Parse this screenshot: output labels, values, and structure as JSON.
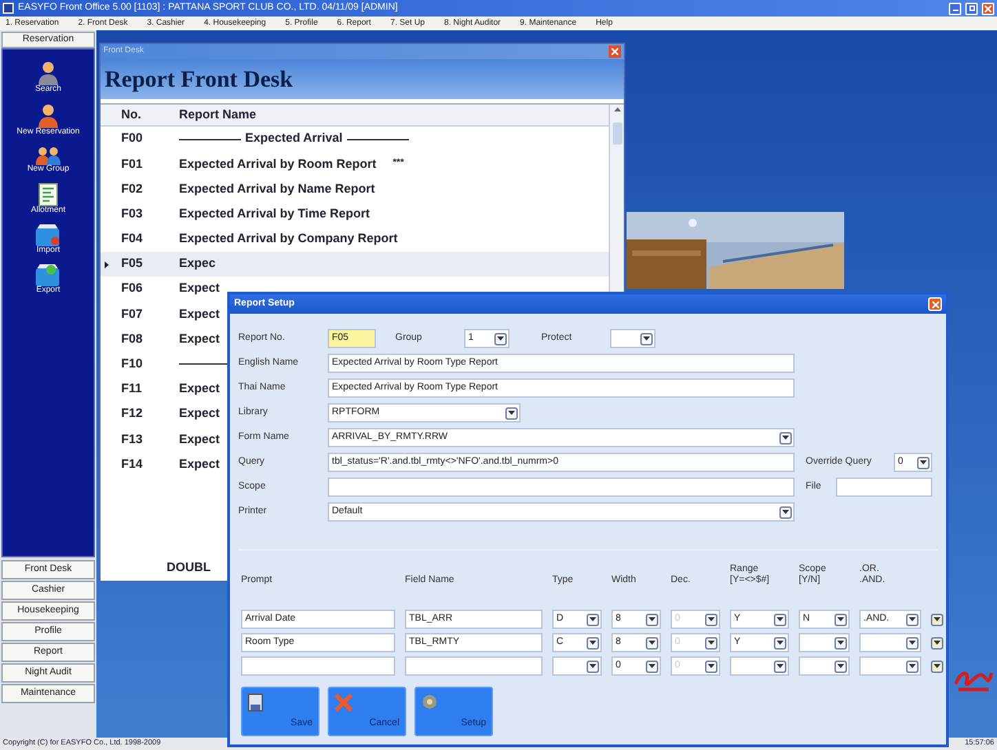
{
  "window": {
    "title": "EASYFO Front Office 5.00 [1103] : PATTANA SPORT CLUB CO., LTD.  04/11/09 [ADMIN]"
  },
  "menu": [
    "1. Reservation",
    "2. Front Desk",
    "3. Cashier",
    "4. Housekeeping",
    "5. Profile",
    "6. Report",
    "7. Set Up",
    "8. Night Auditor",
    "9. Maintenance",
    "Help"
  ],
  "sidebar": {
    "tab": "Reservation",
    "items": [
      {
        "label": "Search",
        "kind": "person"
      },
      {
        "label": "New Reservation",
        "kind": "person-alt"
      },
      {
        "label": "New Group",
        "kind": "group"
      },
      {
        "label": "Allotment",
        "kind": "list"
      },
      {
        "label": "Import",
        "kind": "import"
      },
      {
        "label": "Export",
        "kind": "export"
      }
    ],
    "modules": [
      "Front Desk",
      "Cashier",
      "Housekeeping",
      "Profile",
      "Report",
      "Night Audit",
      "Maintenance"
    ]
  },
  "front_desk": {
    "title": "Front Desk",
    "heading": "Report Front Desk",
    "columns": [
      "No.",
      "Report Name"
    ],
    "rows": [
      {
        "no": "F00",
        "name": "Expected Arrival",
        "kind": "section",
        "selected": false
      },
      {
        "no": "F01",
        "name": "Expected Arrival by Room Report",
        "flag": "***",
        "kind": "report",
        "selected": false
      },
      {
        "no": "F02",
        "name": "Expected Arrival by Name Report",
        "kind": "report",
        "selected": false
      },
      {
        "no": "F03",
        "name": "Expected Arrival by Time Report",
        "kind": "report",
        "selected": false
      },
      {
        "no": "F04",
        "name": "Expected Arrival by Company Report",
        "kind": "report",
        "selected": false
      },
      {
        "no": "F05",
        "name": "Expec",
        "kind": "report",
        "selected": true
      },
      {
        "no": "F06",
        "name": "Expect",
        "kind": "report",
        "selected": false
      },
      {
        "no": "F07",
        "name": "Expect",
        "kind": "report",
        "selected": false
      },
      {
        "no": "F08",
        "name": "Expect",
        "kind": "report",
        "selected": false
      },
      {
        "no": "F10",
        "kind": "section",
        "selected": false
      },
      {
        "no": "F11",
        "name": "Expect",
        "kind": "report",
        "selected": false
      },
      {
        "no": "F12",
        "name": "Expect",
        "kind": "report",
        "selected": false
      },
      {
        "no": "F13",
        "name": "Expect",
        "kind": "report",
        "selected": false
      },
      {
        "no": "F14",
        "name": "Expect",
        "kind": "report",
        "selected": false
      }
    ],
    "footer": "DOUBL"
  },
  "report_setup": {
    "title": "Report Setup",
    "report_no": {
      "label": "Report No.",
      "value": "F05"
    },
    "group": {
      "label": "Group",
      "value": "1"
    },
    "protect": {
      "label": "Protect"
    },
    "english_name": {
      "label": "English Name",
      "value": "Expected Arrival by Room Type Report"
    },
    "thai_name": {
      "label": "Thai Name",
      "value": "Expected Arrival by Room Type Report"
    },
    "library": {
      "label": "Library",
      "value": "RPTFORM"
    },
    "form_name": {
      "label": "Form Name",
      "value": "ARRIVAL_BY_RMTY.RRW"
    },
    "query": {
      "label": "Query",
      "value": "tbl_status='R'.and.tbl_rmty<>'NFO'.and.tbl_numrm>0"
    },
    "override_query": {
      "label": "Override Query",
      "value": "0"
    },
    "scope": {
      "label": "Scope"
    },
    "file": {
      "label": "File"
    },
    "printer": {
      "label": "Printer",
      "value": "Default"
    },
    "grid": {
      "columns": [
        {
          "label": "Prompt",
          "kind": "text",
          "disabled": false
        },
        {
          "label": "Field Name",
          "kind": "text",
          "disabled": false
        },
        {
          "label": "Type",
          "kind": "select",
          "disabled": false
        },
        {
          "label": "Width",
          "kind": "select",
          "disabled": false
        },
        {
          "label": "Dec.",
          "kind": "select",
          "disabled": true
        },
        {
          "label": "Range",
          "sub": "[Y=<>$#]",
          "kind": "select",
          "disabled": false
        },
        {
          "label": "Scope",
          "sub": "[Y/N]",
          "kind": "select",
          "disabled": false
        },
        {
          "label": ".OR.",
          "sub": ".AND.",
          "kind": "select",
          "disabled": false
        }
      ],
      "rows": [
        {
          "cells": [
            "Arrival Date",
            "TBL_ARR",
            "D",
            "8",
            "0",
            "Y",
            "N",
            ".AND."
          ]
        },
        {
          "cells": [
            "Room Type",
            "TBL_RMTY",
            "C",
            "8",
            "0",
            "Y",
            null,
            null
          ]
        },
        {
          "cells": [
            null,
            null,
            null,
            "0",
            "0",
            null,
            null,
            null
          ]
        }
      ]
    },
    "buttons": [
      {
        "label": "Save",
        "kind": "save"
      },
      {
        "label": "Cancel",
        "kind": "cancel"
      },
      {
        "label": "Setup",
        "kind": "setup"
      }
    ]
  },
  "status_bar": {
    "copyright": "Copyright (C) for EASYFO Co., Ltd. 1998-2009",
    "time": "15:57:06"
  }
}
